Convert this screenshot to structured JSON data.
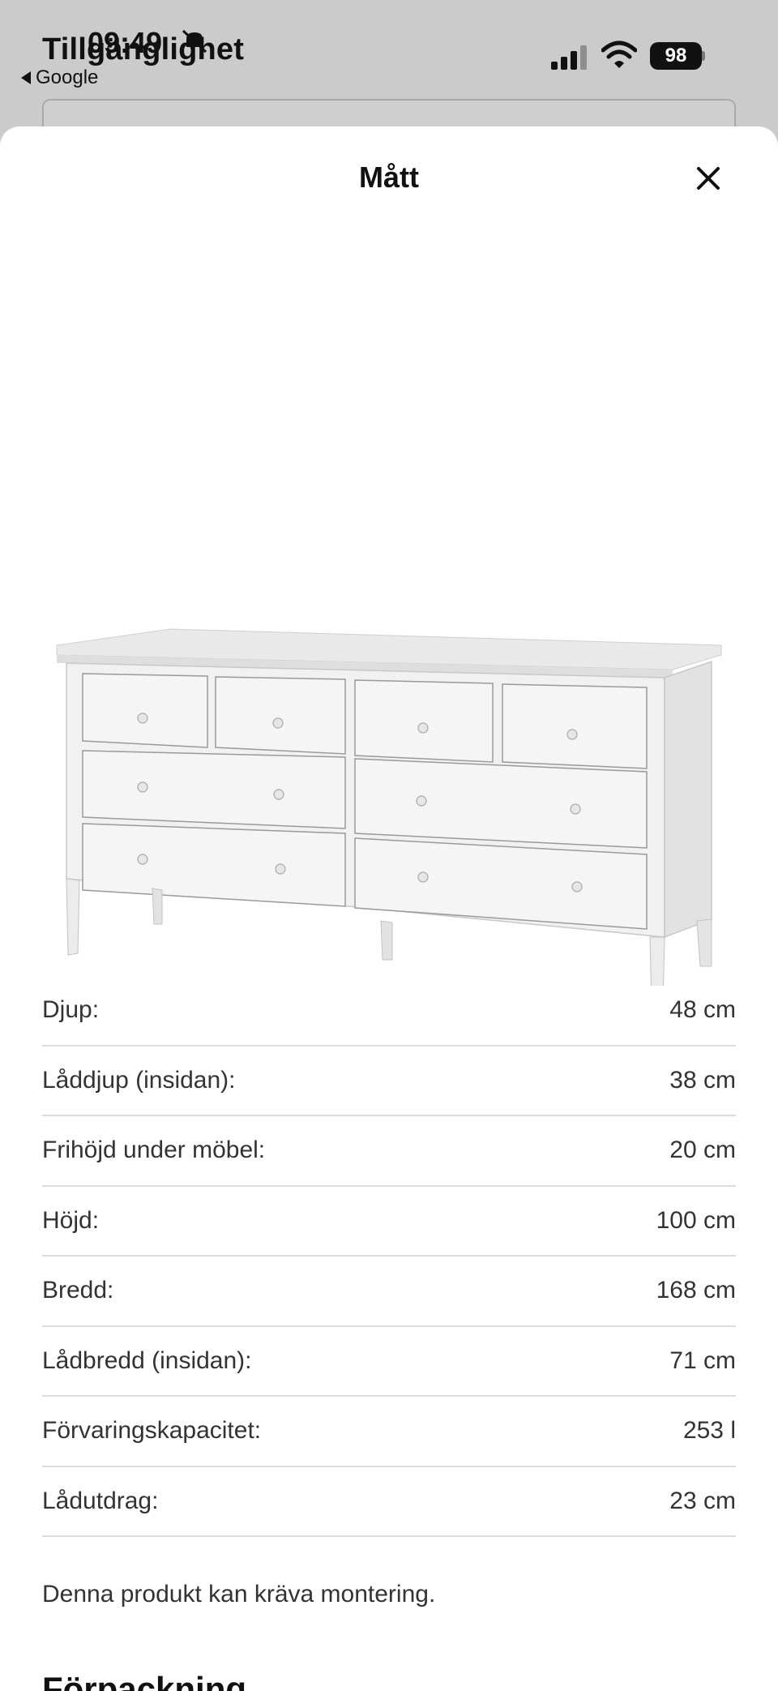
{
  "background_page": {
    "title": "Tillgänglighet"
  },
  "status_bar": {
    "time": "09:49",
    "back_label": "Google",
    "battery": "98"
  },
  "sheet": {
    "title": "Mått",
    "close_icon": "close-icon"
  },
  "product": {
    "image_icon": "dresser-illustration"
  },
  "dimensions": [
    {
      "label": "Djup:",
      "value": "48 cm"
    },
    {
      "label": "Låddjup (insidan):",
      "value": "38 cm"
    },
    {
      "label": "Frihöjd under möbel:",
      "value": "20 cm"
    },
    {
      "label": "Höjd:",
      "value": "100 cm"
    },
    {
      "label": "Bredd:",
      "value": "168 cm"
    },
    {
      "label": "Lådbredd (insidan):",
      "value": "71 cm"
    },
    {
      "label": "Förvaringskapacitet:",
      "value": "253 l"
    },
    {
      "label": "Lådutdrag:",
      "value": "23 cm"
    }
  ],
  "note": "Denna produkt kan kräva montering.",
  "next_section_heading": "Förpackning"
}
